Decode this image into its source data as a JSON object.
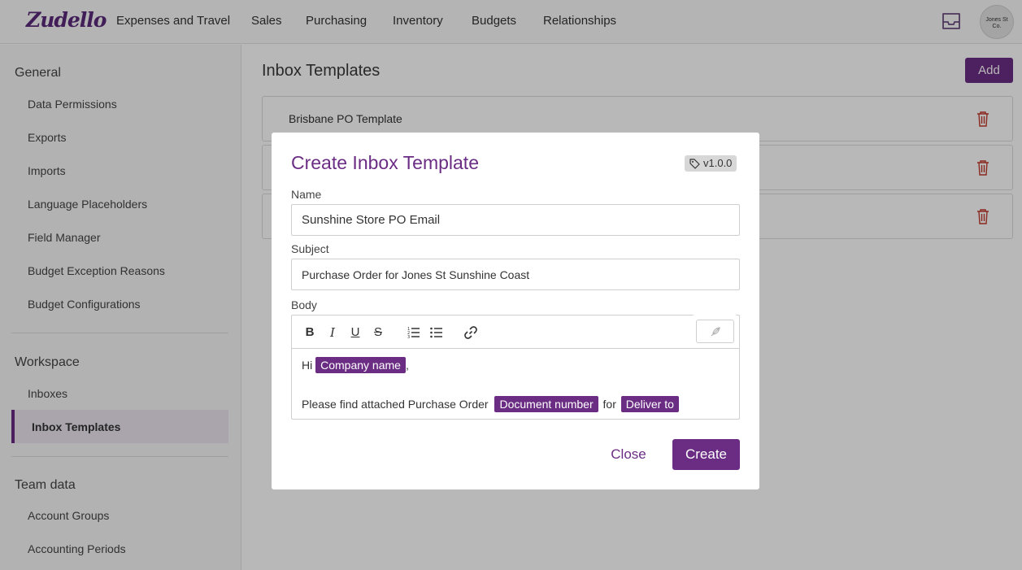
{
  "app": {
    "logo": "Zudello",
    "avatar_text": "Jones St Co."
  },
  "nav": {
    "items": [
      "Expenses and Travel",
      "Sales",
      "Purchasing",
      "Inventory",
      "Budgets",
      "Relationships"
    ]
  },
  "sidebar": {
    "general_heading": "General",
    "general_items": [
      "Data Permissions",
      "Exports",
      "Imports",
      "Language Placeholders",
      "Field Manager",
      "Budget Exception Reasons",
      "Budget Configurations"
    ],
    "workspace_heading": "Workspace",
    "workspace_items": [
      "Inboxes",
      "Inbox Templates"
    ],
    "team_heading": "Team data",
    "team_items": [
      "Account Groups",
      "Accounting Periods"
    ]
  },
  "main": {
    "title": "Inbox Templates",
    "add_label": "Add",
    "templates": [
      "Brisbane PO Template",
      "",
      ""
    ]
  },
  "modal": {
    "title": "Create Inbox Template",
    "version": "v1.0.0",
    "name_label": "Name",
    "name_value": "Sunshine Store PO Email",
    "subject_label": "Subject",
    "subject_value": "Purchase Order for Jones St Sunshine Coast",
    "body_label": "Body",
    "toolbar": [
      "B",
      "I",
      "U",
      "S"
    ],
    "body": {
      "line1_prefix": "Hi",
      "line1_chip": "Company name",
      "line1_suffix": ",",
      "line2_prefix": "Please find attached Purchase Order",
      "line2_chip1": "Document number",
      "line2_mid": "for",
      "line2_chip2": "Deliver to"
    },
    "close_label": "Close",
    "create_label": "Create"
  },
  "colors": {
    "brand": "#6b2d84",
    "delete": "#c0392b"
  }
}
